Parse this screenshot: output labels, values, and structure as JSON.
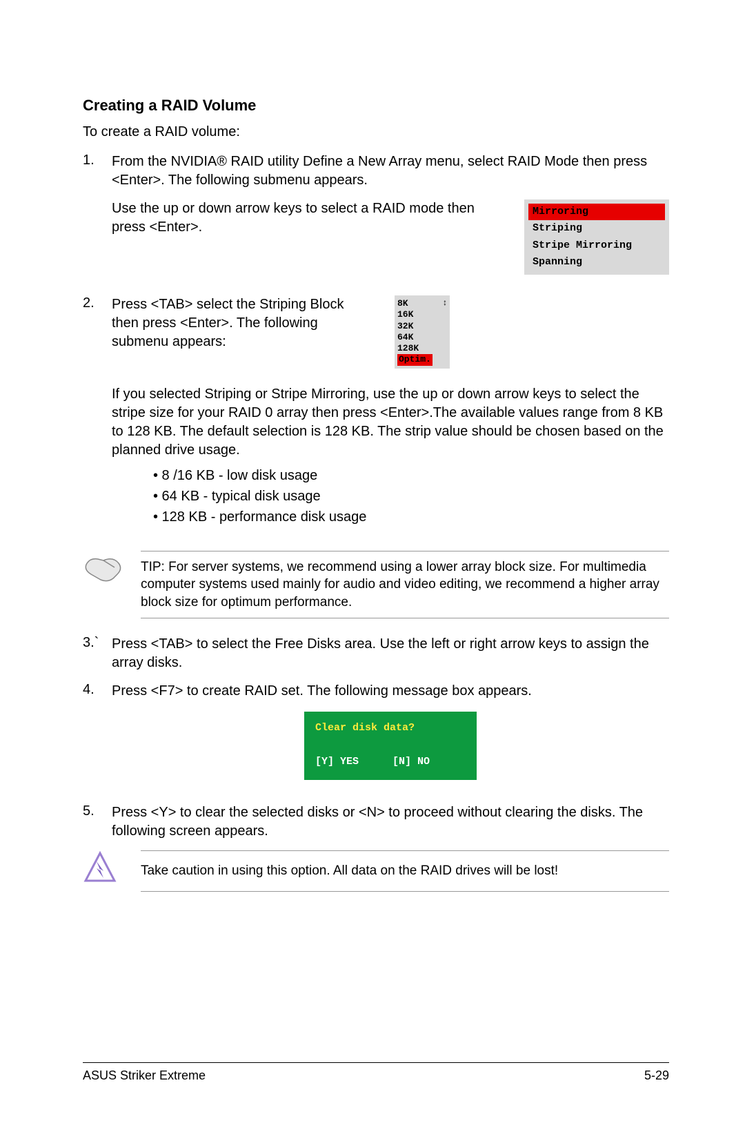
{
  "heading": "Creating a RAID Volume",
  "intro": "To create a RAID volume:",
  "step1_num": "1.",
  "step1_a": "From the NVIDIA® RAID utility Define a New Array menu, select RAID Mode then press <Enter>. The following submenu appears.",
  "step1_b": "Use the up or down arrow keys to select a RAID mode then press <Enter>.",
  "raid_modes": {
    "sel": "Mirroring",
    "i1": "Striping",
    "i2": "Stripe Mirroring",
    "i3": "Spanning"
  },
  "step2_num": "2.",
  "step2_a": "Press <TAB> select the Striping Block then press <Enter>. The following submenu appears:",
  "stripe": {
    "i0": "8K",
    "i1": "16K",
    "i2": "32K",
    "i3": "64K",
    "i4": "128K",
    "sel": "Optim.",
    "arrow": "↕"
  },
  "step2_b": "If you selected Striping or Stripe Mirroring, use the up or down arrow keys to select the stripe size for your RAID 0 array then press <Enter>.The available values range from 8 KB to 128 KB. The default selection is 128 KB. The strip value should be chosen based on the planned drive usage.",
  "bullets": {
    "b1": "• 8 /16 KB - low disk usage",
    "b2": "• 64 KB - typical disk usage",
    "b3": "• 128 KB - performance disk usage"
  },
  "tip": "TIP: For server systems, we recommend using a lower array block size. For multimedia computer systems used mainly for audio and video editing, we recommend a higher array block size for optimum performance.",
  "step3_num": "3.`",
  "step3_a": "Press <TAB> to select the Free Disks area. Use the left or right arrow keys to assign the array disks.",
  "step4_num": "4.",
  "step4_a": "Press <F7> to create RAID set. The following message box appears.",
  "dialog": {
    "title": "Clear disk data?",
    "yes": "[Y] YES",
    "no": "[N] NO"
  },
  "step5_num": "5.",
  "step5_a": "Press <Y> to clear the selected disks or <N> to proceed without clearing the disks. The following screen appears.",
  "caution": "Take caution in using this option. All data on the RAID drives will be lost!",
  "footer_left": "ASUS Striker Extreme",
  "footer_right": "5-29"
}
